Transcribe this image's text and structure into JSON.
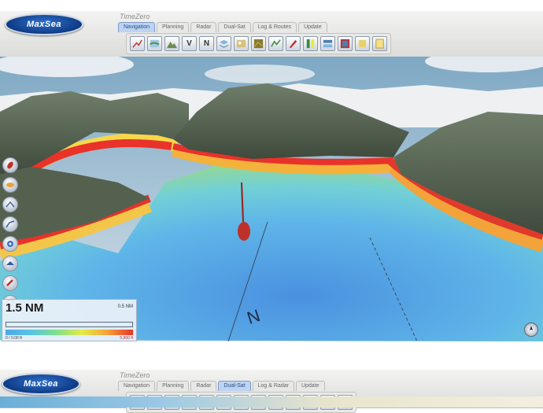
{
  "app": {
    "logo_text": "MaxSea",
    "brand": "TimeZero"
  },
  "tabs": [
    {
      "label": "Navigation",
      "active": true
    },
    {
      "label": "Planning",
      "active": false
    },
    {
      "label": "Radar",
      "active": false
    },
    {
      "label": "Dual-Sat",
      "active": false
    },
    {
      "label": "Log & Routes",
      "active": false
    },
    {
      "label": "Update",
      "active": false
    }
  ],
  "tabs_bottom": [
    {
      "label": "Navigation",
      "active": false
    },
    {
      "label": "Planning",
      "active": false
    },
    {
      "label": "Radar",
      "active": false
    },
    {
      "label": "Dual-Sat",
      "active": true
    },
    {
      "label": "Log & Radar",
      "active": false
    },
    {
      "label": "Update",
      "active": false
    }
  ],
  "toolbar": [
    {
      "icon": "route-icon",
      "label": ""
    },
    {
      "icon": "chart-icon",
      "label": ""
    },
    {
      "icon": "terrain-icon",
      "label": ""
    },
    {
      "icon": "view-mode-icon",
      "label": "V"
    },
    {
      "icon": "north-up-icon",
      "label": "N"
    },
    {
      "icon": "layer-icon",
      "label": ""
    },
    {
      "icon": "photo-icon",
      "label": ""
    },
    {
      "icon": "satellite-icon",
      "label": ""
    },
    {
      "icon": "tide-icon",
      "label": ""
    },
    {
      "icon": "edit-icon",
      "label": ""
    },
    {
      "icon": "depth-icon",
      "label": ""
    },
    {
      "icon": "pause-icon",
      "label": ""
    },
    {
      "icon": "grid-icon",
      "label": ""
    },
    {
      "icon": "3d-icon",
      "label": ""
    },
    {
      "icon": "note-icon",
      "label": ""
    }
  ],
  "side_tools": [
    "boat-icon",
    "ellipse-icon",
    "draw-icon",
    "route-point-icon",
    "target-icon",
    "layers-icon",
    "mob-icon",
    "settings-icon"
  ],
  "scale": {
    "value": "1.5 NM",
    "small": "0.5 NM",
    "range_low": "0 / 0.00 ft",
    "range_high": "5,900 ft"
  },
  "chart_labels": {
    "north": "N"
  },
  "colors": {
    "shallow": "#e8322a",
    "mid": "#e4ea4a",
    "deep": "#4fa7e6",
    "accent": "#7e9cc8"
  }
}
